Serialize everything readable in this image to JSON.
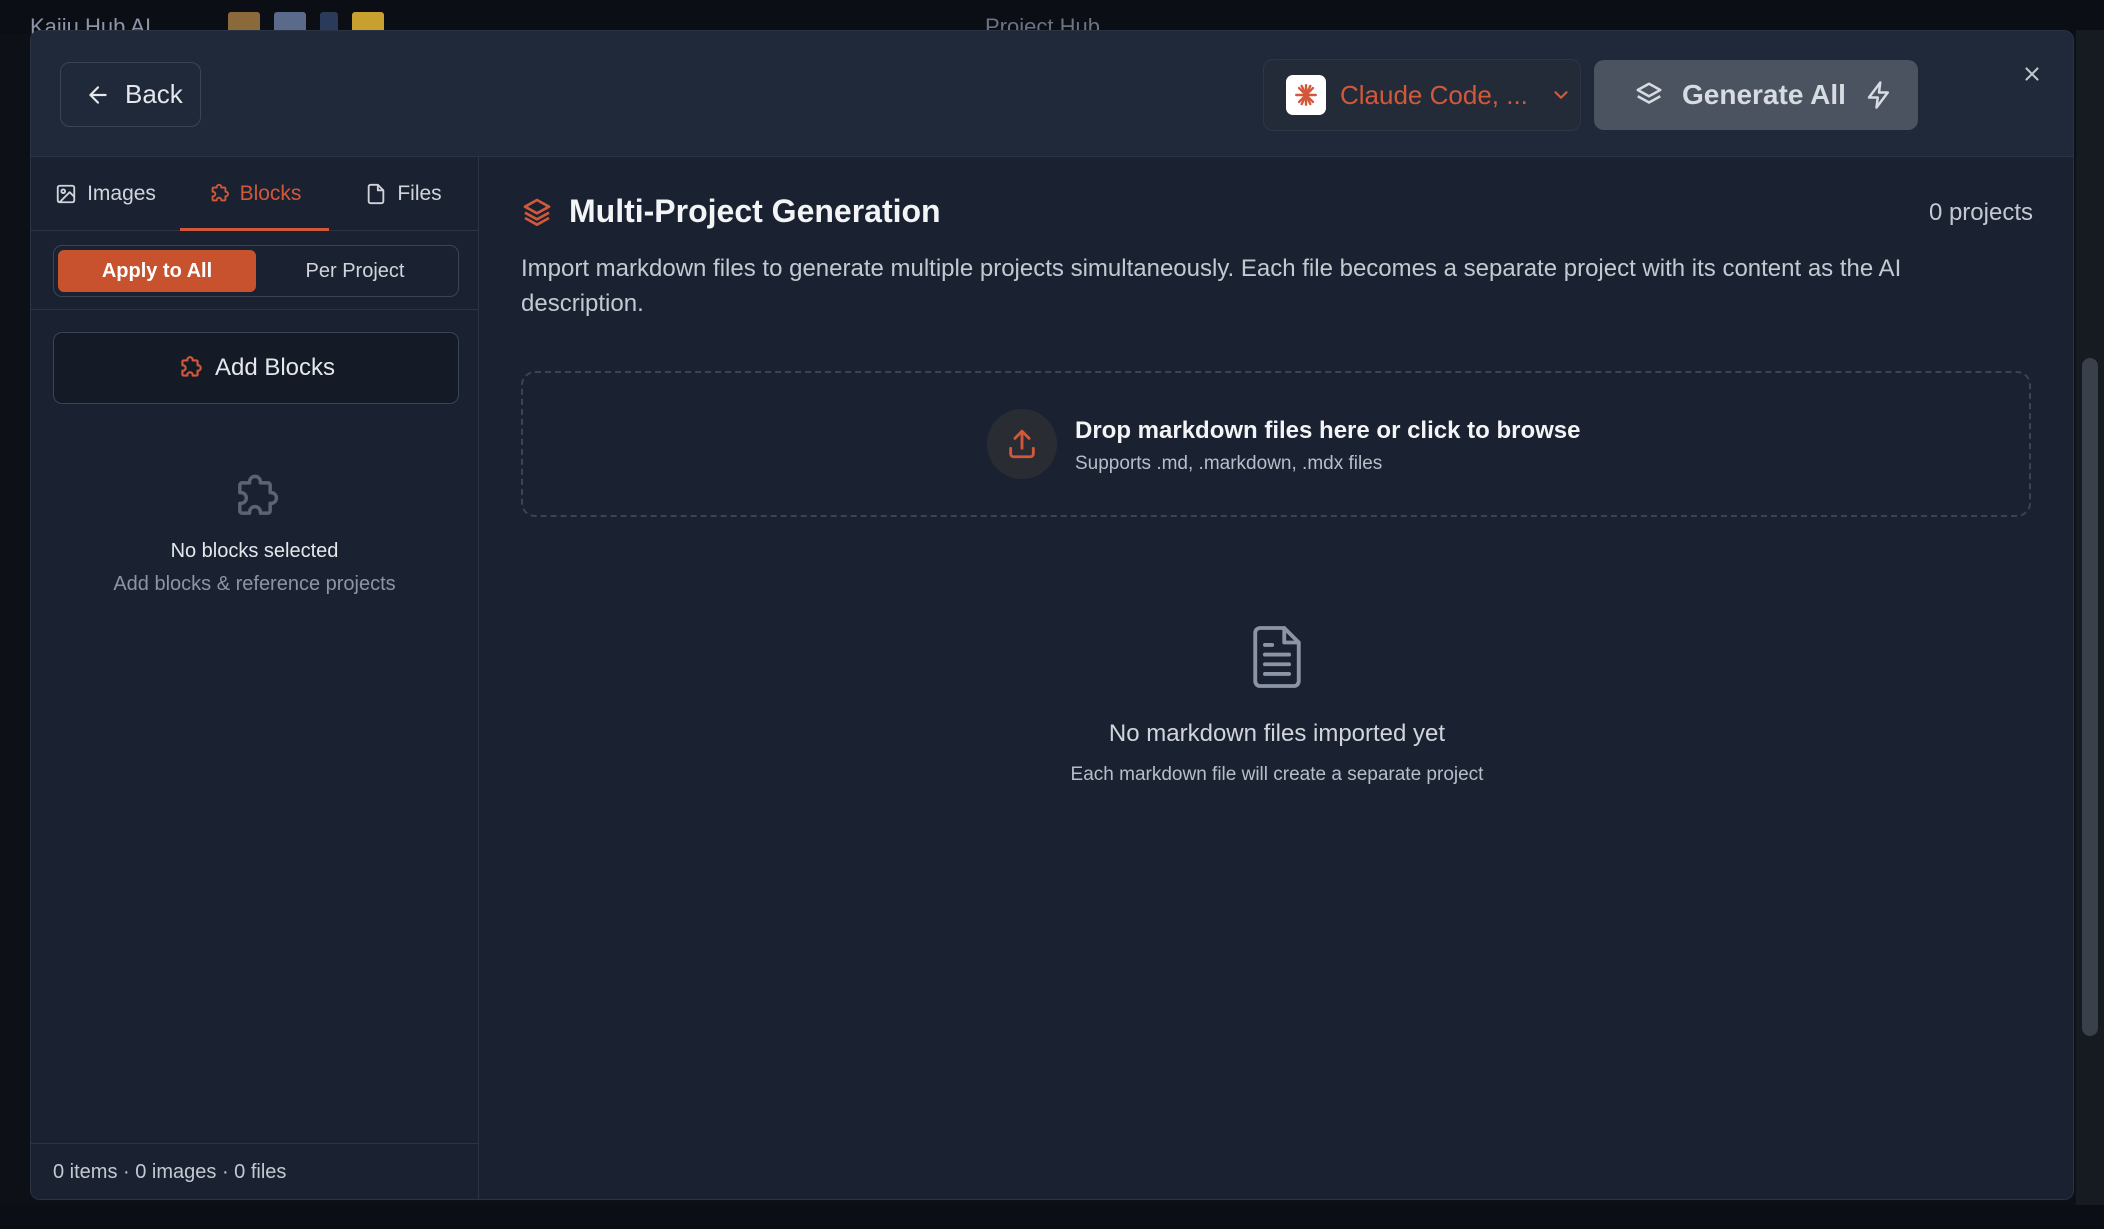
{
  "background": {
    "app_name": "Kaiju Hub AI",
    "window_title": "Project Hub"
  },
  "header": {
    "back_label": "Back",
    "model_label": "Claude Code, ...",
    "generate_label": "Generate All"
  },
  "sidebar": {
    "tabs": [
      {
        "label": "Images",
        "icon": "image-icon",
        "active": false
      },
      {
        "label": "Blocks",
        "icon": "puzzle-icon",
        "active": true
      },
      {
        "label": "Files",
        "icon": "file-icon",
        "active": false
      }
    ],
    "modes": [
      {
        "label": "Apply to All",
        "active": true
      },
      {
        "label": "Per Project",
        "active": false
      }
    ],
    "add_blocks_label": "Add Blocks",
    "empty_title": "No blocks selected",
    "empty_subtitle": "Add blocks & reference projects",
    "footer": "0 items · 0 images · 0 files"
  },
  "main": {
    "title": "Multi-Project Generation",
    "project_count": "0 projects",
    "description": "Import markdown files to generate multiple projects simultaneously. Each file becomes a separate project with its content as the AI description.",
    "dropzone": {
      "title": "Drop markdown files here or click to browse",
      "subtitle": "Supports .md, .markdown, .mdx files"
    },
    "empty_title": "No markdown files imported yet",
    "empty_subtitle": "Each markdown file will create a separate project"
  },
  "colors": {
    "accent": "#d2583a",
    "background": "#1a2232",
    "header": "#1f293a",
    "border": "#2b3444"
  }
}
